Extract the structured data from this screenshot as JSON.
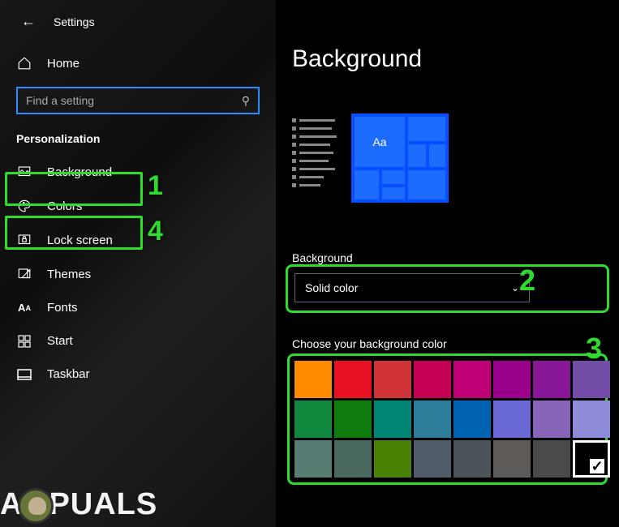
{
  "titlebar": {
    "title": "Settings"
  },
  "home_label": "Home",
  "search": {
    "placeholder": "Find a setting"
  },
  "section_label": "Personalization",
  "nav": [
    {
      "icon": "picture-icon",
      "label": "Background"
    },
    {
      "icon": "palette-icon",
      "label": "Colors"
    },
    {
      "icon": "lock-icon",
      "label": "Lock screen"
    },
    {
      "icon": "themes-icon",
      "label": "Themes"
    },
    {
      "icon": "fonts-icon",
      "label": "Fonts"
    },
    {
      "icon": "start-icon",
      "label": "Start"
    },
    {
      "icon": "taskbar-icon",
      "label": "Taskbar"
    }
  ],
  "annotations": {
    "a1": "1",
    "a4": "4",
    "a2": "2",
    "a3": "3"
  },
  "main": {
    "page_title": "Background",
    "preview_text": "Aa",
    "dropdown_label": "Background",
    "dropdown_value": "Solid color",
    "choose_label": "Choose your background color",
    "swatches": [
      [
        "#ff8c00",
        "#e81123",
        "#d13438",
        "#c30052",
        "#bf0077",
        "#9a0089",
        "#881798",
        "#744da9"
      ],
      [
        "#10893e",
        "#107c10",
        "#018574",
        "#2d7d9a",
        "#0063b1",
        "#6b69d6",
        "#8764b8",
        "#8e8cd8"
      ],
      [
        "#567c73",
        "#486860",
        "#498205",
        "#515c6b",
        "#4a5459",
        "#5d5a58",
        "#4c4a48",
        "#000000"
      ]
    ],
    "selected_swatch": "#000000"
  },
  "watermark": "A  PUALS"
}
